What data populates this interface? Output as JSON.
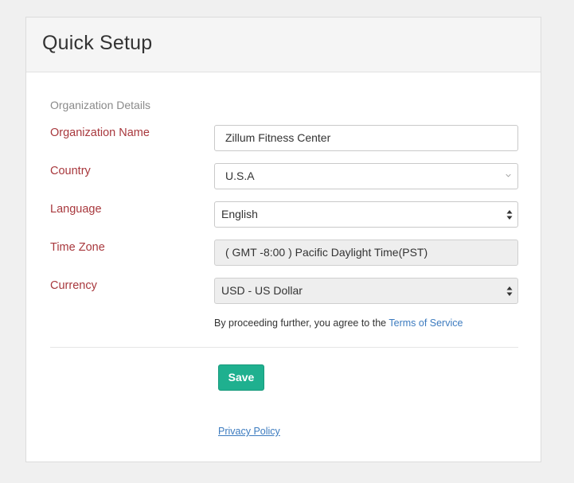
{
  "header": {
    "title": "Quick Setup"
  },
  "form": {
    "section_label": "Organization Details",
    "org_name": {
      "label": "Organization Name",
      "value": "Zillum Fitness Center"
    },
    "country": {
      "label": "Country",
      "value": "U.S.A",
      "icon": "chevron-down-icon"
    },
    "language": {
      "label": "Language",
      "value": "English",
      "icon": "up-down-arrows-icon"
    },
    "timezone": {
      "label": "Time Zone",
      "value": "( GMT -8:00 ) Pacific Daylight Time(PST)"
    },
    "currency": {
      "label": "Currency",
      "value": "USD - US Dollar",
      "icon": "up-down-arrows-icon"
    },
    "terms_text": "By proceeding further, you agree to the",
    "terms_link": "Terms of Service"
  },
  "actions": {
    "save_label": "Save"
  },
  "footer": {
    "privacy_link": "Privacy Policy"
  },
  "colors": {
    "label_red": "#a8383d",
    "save_green": "#1fb08f",
    "link_blue": "#3c7bbf",
    "background": "#f0f0f0"
  }
}
